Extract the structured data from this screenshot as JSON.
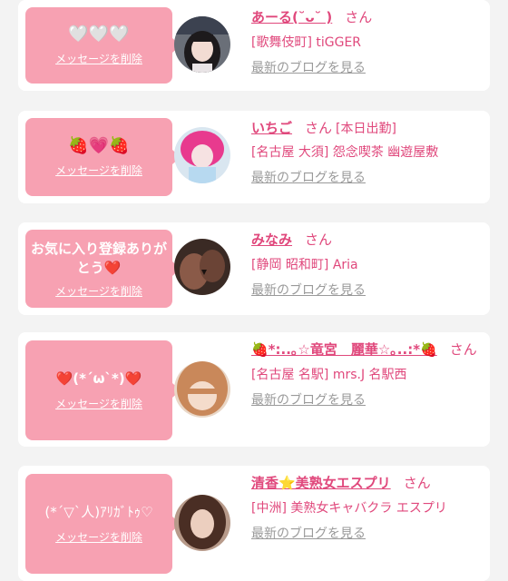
{
  "delete_label": "メッセージを削除",
  "blog_label": "最新のブログを見る",
  "entries": [
    {
      "message": "🤍🤍🤍",
      "name": "あーる(˘ᴗ˘ )",
      "san": "さん",
      "shop": "[歌舞伎町] tiGGER"
    },
    {
      "message": "🍓💗🍓",
      "name": "いちご",
      "san": "さん",
      "shop_line1": "[本日出勤]",
      "shop": "[名古屋 大須] 怨念喫茶 幽遊屋敷"
    },
    {
      "message": "お気に入り登録ありがとう❤️",
      "name": "みなみ",
      "san": "さん",
      "shop": "[静岡 昭和町] Aria"
    },
    {
      "message": "❤️(*´ω`*)❤️",
      "name": "🍓*:..｡☆竜宮　麗華☆｡..:*🍓",
      "san": "さん",
      "shop": "[名古屋 名駅] mrs.J 名駅西"
    },
    {
      "message": "(*´▽`人)ｱﾘｶﾞﾄｩ♡",
      "name": "清香⭐美熟女エスプリ",
      "san": "さん",
      "shop": "[中洲] 美熟女キャバクラ エスプリ"
    }
  ],
  "colors": {
    "bubble": "#f7a1b2",
    "name": "#e0487c",
    "link_gray": "#9a9a9a",
    "background": "#f3f3f3"
  }
}
